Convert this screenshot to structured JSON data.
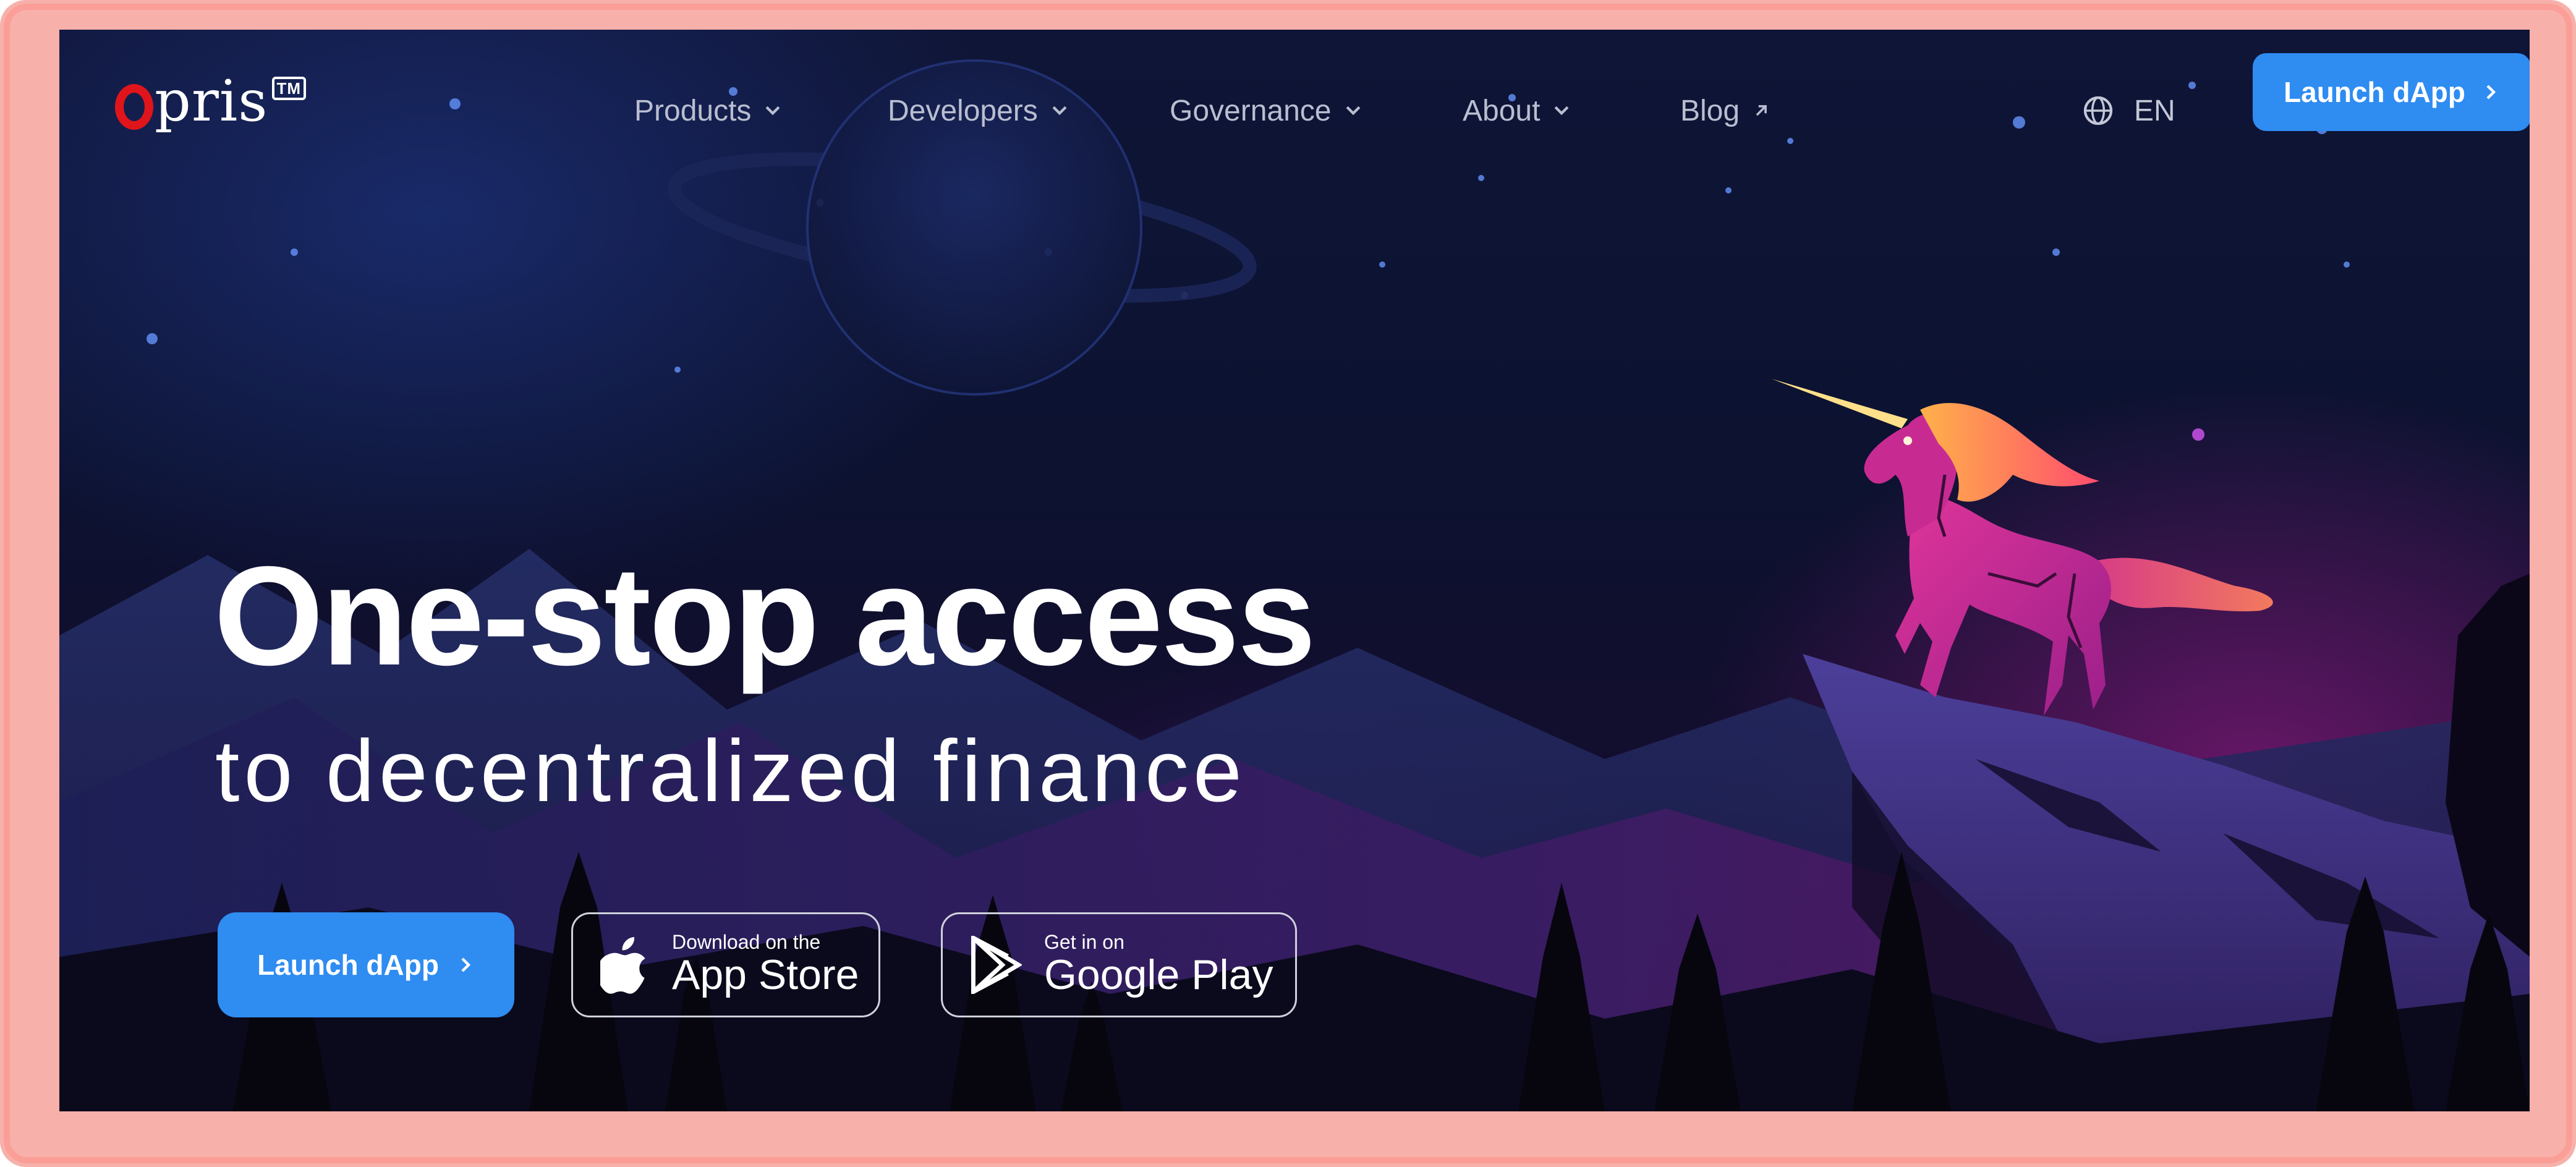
{
  "brand": {
    "name": "Opris",
    "name_rest": "pris",
    "trademark": "TM",
    "logo_color": "#e0151b"
  },
  "nav": {
    "items": [
      {
        "label": "Products",
        "icon": "chevron-down-icon"
      },
      {
        "label": "Developers",
        "icon": "chevron-down-icon"
      },
      {
        "label": "Governance",
        "icon": "chevron-down-icon"
      },
      {
        "label": "About",
        "icon": "chevron-down-icon"
      },
      {
        "label": "Blog",
        "icon": "external-link-icon"
      }
    ],
    "language": {
      "label": "EN",
      "icon": "globe-icon"
    },
    "launch_button": {
      "label": "Launch dApp",
      "icon": "chevron-right-icon"
    }
  },
  "hero": {
    "headline": "One-stop access",
    "subheadline": "to decentralized finance",
    "launch_button": {
      "label": "Launch dApp",
      "icon": "chevron-right-icon"
    },
    "app_store": {
      "small": "Download on the",
      "big": "App Store",
      "icon": "apple-icon"
    },
    "google_play": {
      "small": "Get in on",
      "big": "Google Play",
      "icon": "play-store-icon"
    }
  },
  "colors": {
    "accent": "#2f8cf1",
    "frame": "#f7b0aa"
  }
}
